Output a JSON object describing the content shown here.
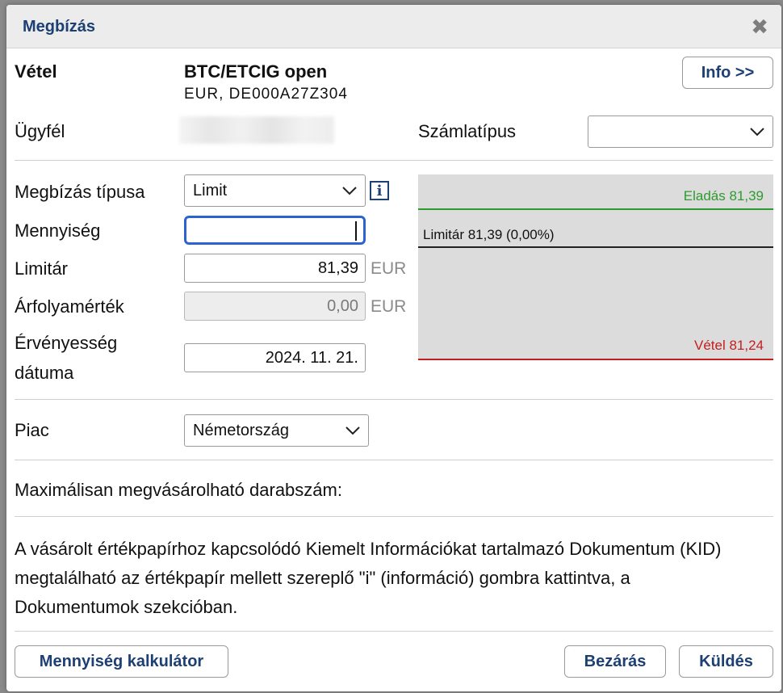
{
  "dialog": {
    "title": "Megbízás"
  },
  "header": {
    "side": "Vétel",
    "instrument_name": "BTC/ETCIG open",
    "instrument_details": "EUR, DE000A27Z304",
    "info_button": "Info >>"
  },
  "client": {
    "label": "Ügyfél",
    "account_type_label": "Számlatípus",
    "account_type_value": ""
  },
  "order": {
    "type_label": "Megbízás típusa",
    "type_value": "Limit",
    "quantity_label": "Mennyiség",
    "quantity_value": "",
    "limit_label": "Limitár",
    "limit_value": "81,39",
    "limit_unit": "EUR",
    "rate_label": "Árfolyamérték",
    "rate_value": "0,00",
    "rate_unit": "EUR",
    "validity_label_line1": "Érvényesség",
    "validity_label_line2": "dátuma",
    "validity_value": "2024. 11. 21."
  },
  "price_panel": {
    "sell": "Eladás 81,39",
    "limit": "Limitár 81,39 (0,00%)",
    "buy": "Vétel 81,24",
    "colors": {
      "sell": "#2e9b2e",
      "buy": "#c41e1e",
      "limit": "#111111"
    }
  },
  "market": {
    "label": "Piac",
    "value": "Németország"
  },
  "max_quantity_label": "Maximálisan megvásárolható darabszám:",
  "kid_notice": {
    "line1": "A vásárolt értékpapírhoz kapcsolódó Kiemelt Információkat tartalmazó Dokumentum (KID)",
    "line2": "megtalálható az értékpapír mellett szereplő \"i\" (információ) gombra kattintva, a",
    "line3": "Dokumentumok szekcióban."
  },
  "footer": {
    "calculator_button": "Mennyiség kalkulátor",
    "close_button": "Bezárás",
    "send_button": "Küldés"
  },
  "icons": {
    "close": "close-icon",
    "info": "info-icon",
    "chevron": "chevron-down-icon"
  },
  "accent_color": "#1d3f73"
}
